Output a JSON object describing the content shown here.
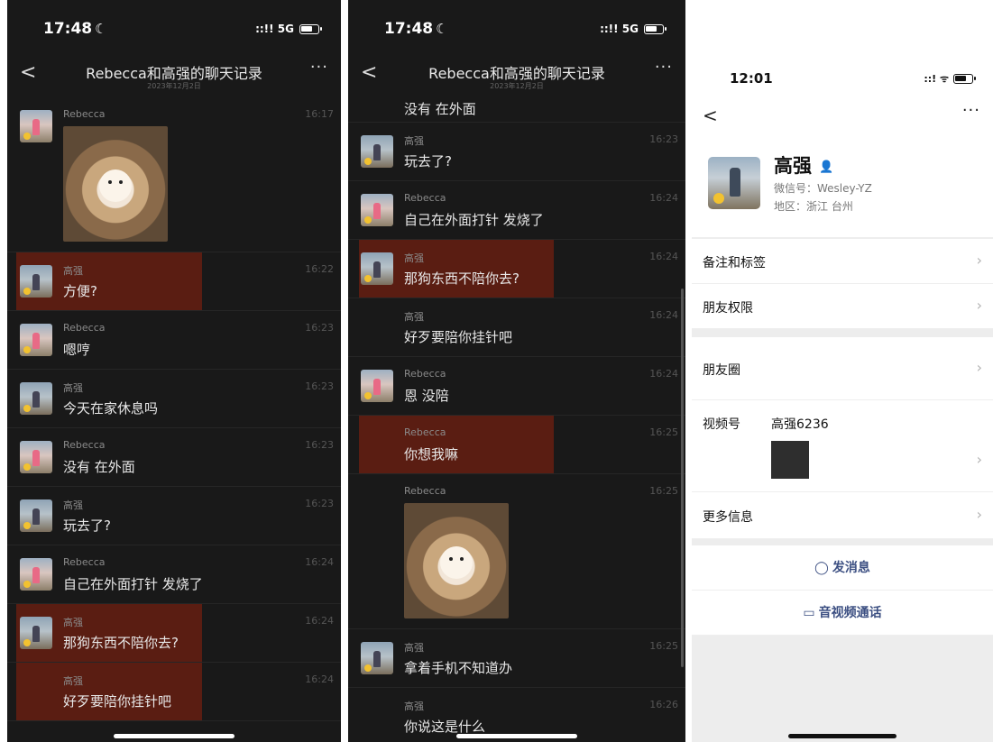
{
  "chat": {
    "title": "Rebecca和高强的聊天记录",
    "date": "2023年12月2日",
    "back_glyph": "<",
    "more_glyph": "···"
  },
  "status": {
    "time": "17:48",
    "moon": "☾",
    "signal": "::!! 5G"
  },
  "left_messages": [
    {
      "sender": "Rebecca",
      "time": "16:17",
      "type": "image"
    },
    {
      "sender": "高强",
      "time": "16:22",
      "text": "方便?",
      "highlight": true
    },
    {
      "sender": "Rebecca",
      "time": "16:23",
      "text": "嗯哼"
    },
    {
      "sender": "高强",
      "time": "16:23",
      "text": "今天在家休息吗"
    },
    {
      "sender": "Rebecca",
      "time": "16:23",
      "text": "没有 在外面"
    },
    {
      "sender": "高强",
      "time": "16:23",
      "text": "玩去了?"
    },
    {
      "sender": "Rebecca",
      "time": "16:24",
      "text": "自己在外面打针 发烧了"
    },
    {
      "sender": "高强",
      "time": "16:24",
      "text": "那狗东西不陪你去?",
      "highlight": true
    },
    {
      "sender": "高强",
      "time": "16:24",
      "text": "好歹要陪你挂针吧",
      "highlight": true,
      "noavatar": true
    }
  ],
  "right_messages": [
    {
      "text": "没有 在外面"
    },
    {
      "sender": "高强",
      "time": "16:23",
      "text": "玩去了?"
    },
    {
      "sender": "Rebecca",
      "time": "16:24",
      "text": "自己在外面打针 发烧了"
    },
    {
      "sender": "高强",
      "time": "16:24",
      "text": "那狗东西不陪你去?",
      "highlight": true
    },
    {
      "sender": "高强",
      "time": "16:24",
      "text": "好歹要陪你挂针吧",
      "noavatar": true
    },
    {
      "sender": "Rebecca",
      "time": "16:24",
      "text": "恩 没陪"
    },
    {
      "sender": "Rebecca",
      "time": "16:25",
      "text": "你想我嘛",
      "highlight": true,
      "noavatar": true
    },
    {
      "sender": "Rebecca",
      "time": "16:25",
      "type": "image",
      "noavatar": true
    },
    {
      "sender": "高强",
      "time": "16:25",
      "text": "拿着手机不知道办"
    },
    {
      "sender": "高强",
      "time": "16:26",
      "text": "你说这是什么",
      "noavatar": true
    }
  ],
  "profile": {
    "time": "12:01",
    "name": "高强",
    "wechat_id": "微信号：Wesley-YZ",
    "region": "地区：浙江 台州",
    "rows": {
      "remarks": "备注和标签",
      "permissions": "朋友权限",
      "moments": "朋友圈",
      "channels_label": "视频号",
      "channels_value": "高强6236",
      "more_info": "更多信息"
    },
    "send_message": "发消息",
    "video_call": "音视频通话"
  }
}
